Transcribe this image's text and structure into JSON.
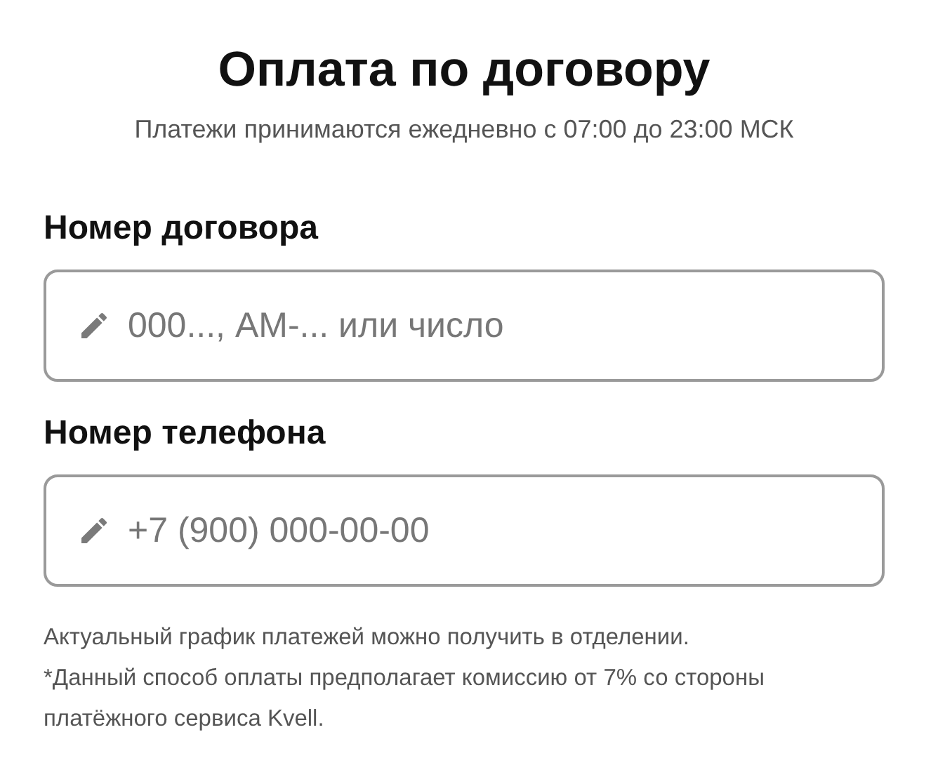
{
  "title": "Оплата по договору",
  "subtitle": "Платежи принимаются ежедневно с 07:00 до 23:00 МСК",
  "fields": [
    {
      "label": "Номер договора",
      "placeholder": "000..., АМ-... или число"
    },
    {
      "label": "Номер телефона",
      "placeholder": "+7 (900) 000-00-00"
    }
  ],
  "notes": [
    "Актуальный график платежей можно получить в отделении.",
    "*Данный способ оплаты предполагает комиссию от 7% со стороны платёжного сервиса Kvell."
  ]
}
